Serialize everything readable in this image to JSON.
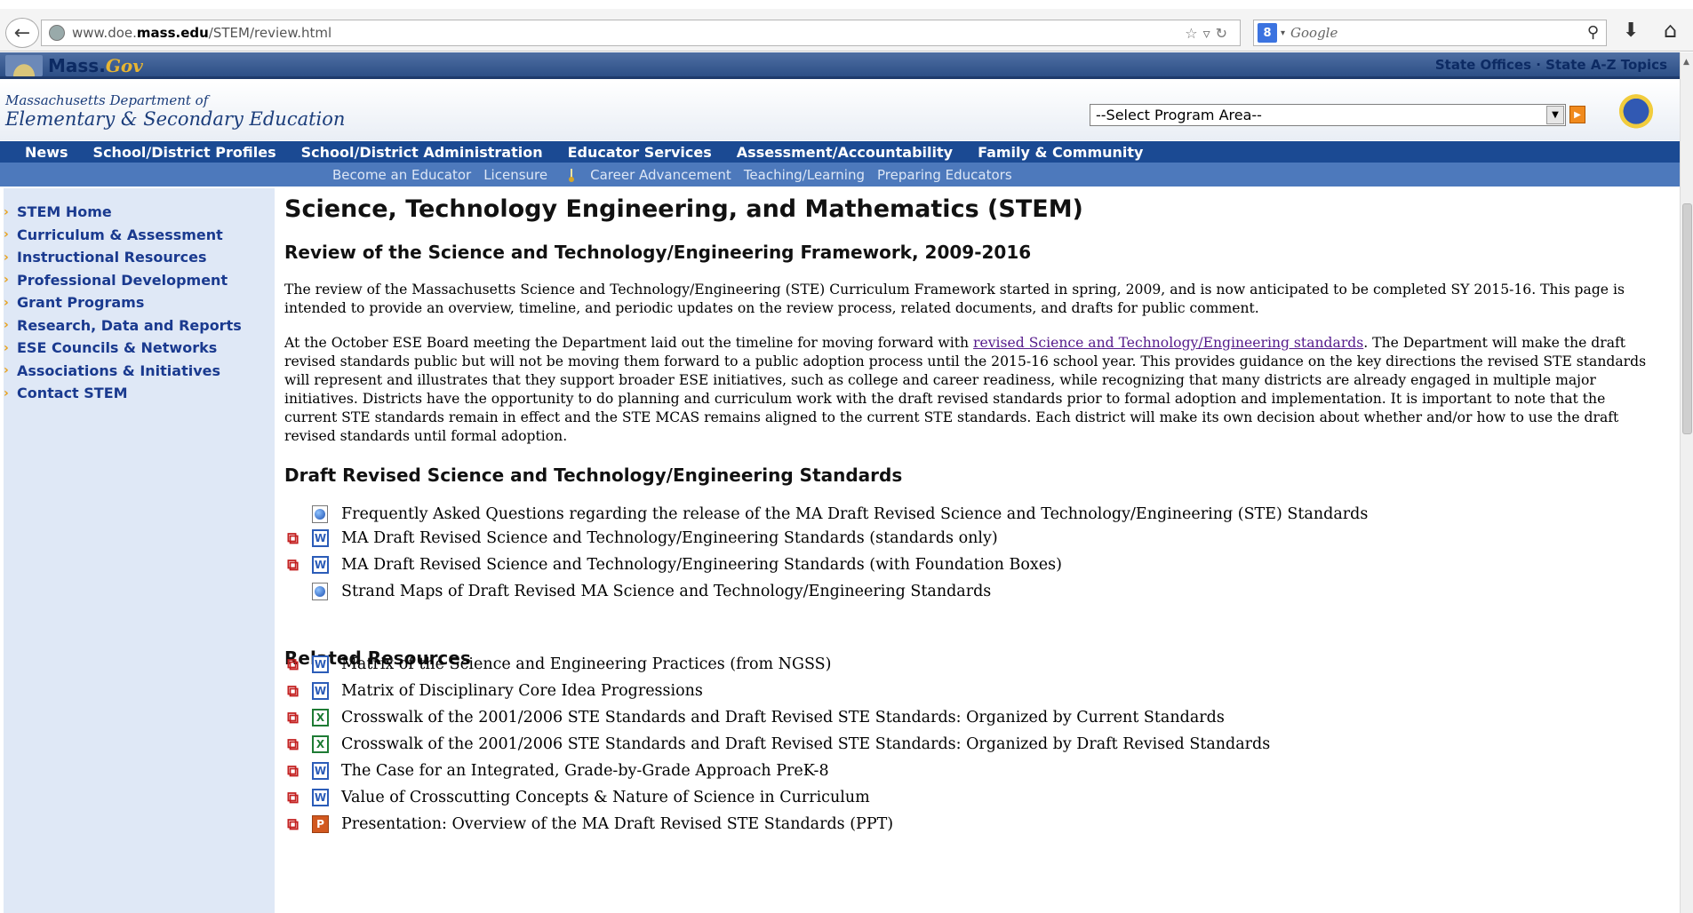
{
  "browser": {
    "url_prefix": "www.doe.",
    "url_domain": "mass.edu",
    "url_path": "/STEM/review.html",
    "search_engine_label": "8",
    "search_placeholder": "Google"
  },
  "massgov": {
    "logo_text": "Mass.",
    "logo_gov": "Gov",
    "links": "State Offices · State A-Z Topics"
  },
  "ese": {
    "line1": "Massachusetts Department of",
    "line2": "Elementary & Secondary Education",
    "program_select": "--Select Program Area--"
  },
  "main_nav": [
    "News",
    "School/District Profiles",
    "School/District Administration",
    "Educator Services",
    "Assessment/Accountability",
    "Family & Community"
  ],
  "sub_nav": {
    "left": [
      "Become an Educator",
      "Licensure"
    ],
    "right": [
      "Career Advancement",
      "Teaching/Learning",
      "Preparing Educators"
    ]
  },
  "sidebar": [
    "STEM Home",
    "Curriculum & Assessment",
    "Instructional Resources",
    "Professional Development",
    "Grant Programs",
    "Research, Data and Reports",
    "ESE Councils & Networks",
    "Associations & Initiatives",
    "Contact STEM"
  ],
  "content": {
    "title": "Science, Technology Engineering, and Mathematics (STEM)",
    "subtitle": "Review of the Science and Technology/Engineering Framework, 2009-2016",
    "para1": "The review of the Massachusetts Science and Technology/Engineering (STE) Curriculum Framework started in spring, 2009, and is now anticipated to be completed SY 2015-16. This page is intended to provide an overview, timeline, and periodic updates on the review process, related documents, and drafts for public comment.",
    "para2_before": "At the October ESE Board meeting the Department laid out the timeline for moving forward with ",
    "para2_link": "revised Science and Technology/Engineering standards",
    "para2_after": ". The Department will make the draft revised standards public but will not be moving them forward to a public adoption process until the 2015-16 school year. This provides guidance on the key directions the revised STE standards will represent and illustrates that they support broader ESE initiatives, such as college and career readiness, while recognizing that many districts are already engaged in multiple major initiatives. Districts have the opportunity to do planning and curriculum work with the draft revised standards prior to formal adoption and implementation. It is important to note that the current STE standards remain in effect and the STE MCAS remains aligned to the current STE standards. Each district will make its own decision about whether and/or how to use the draft revised standards until formal adoption.",
    "section1": "Draft Revised Science and Technology/Engineering Standards",
    "section2": "Related Resources",
    "draft_docs": [
      {
        "label": "Frequently Asked Questions regarding the release of the MA Draft Revised Science and Technology/Engineering (STE) Standards",
        "pdf": false,
        "type": "html"
      },
      {
        "label": "MA Draft Revised Science and Technology/Engineering Standards (standards only)",
        "pdf": true,
        "type": "word"
      },
      {
        "label": "MA Draft Revised Science and Technology/Engineering Standards (with Foundation Boxes)",
        "pdf": true,
        "type": "word"
      },
      {
        "label": "Strand Maps of Draft Revised MA Science and Technology/Engineering Standards",
        "pdf": false,
        "type": "html"
      }
    ],
    "related_docs": [
      {
        "label": "Matrix of the Science and Engineering Practices (from NGSS)",
        "pdf": true,
        "type": "word"
      },
      {
        "label": "Matrix of Disciplinary Core Idea Progressions",
        "pdf": true,
        "type": "word"
      },
      {
        "label": "Crosswalk of the 2001/2006 STE Standards and Draft Revised STE Standards: Organized by Current Standards",
        "pdf": true,
        "type": "excel"
      },
      {
        "label": "Crosswalk of the 2001/2006 STE Standards and Draft Revised STE Standards: Organized by Draft Revised Standards",
        "pdf": true,
        "type": "excel"
      },
      {
        "label": "The Case for an Integrated, Grade-by-Grade Approach PreK-8",
        "pdf": true,
        "type": "word"
      },
      {
        "label": "Value of Crosscutting Concepts & Nature of Science in Curriculum",
        "pdf": true,
        "type": "word"
      },
      {
        "label": "Presentation: Overview of the MA Draft Revised STE Standards (PPT)",
        "pdf": true,
        "type": "ppt"
      }
    ]
  }
}
